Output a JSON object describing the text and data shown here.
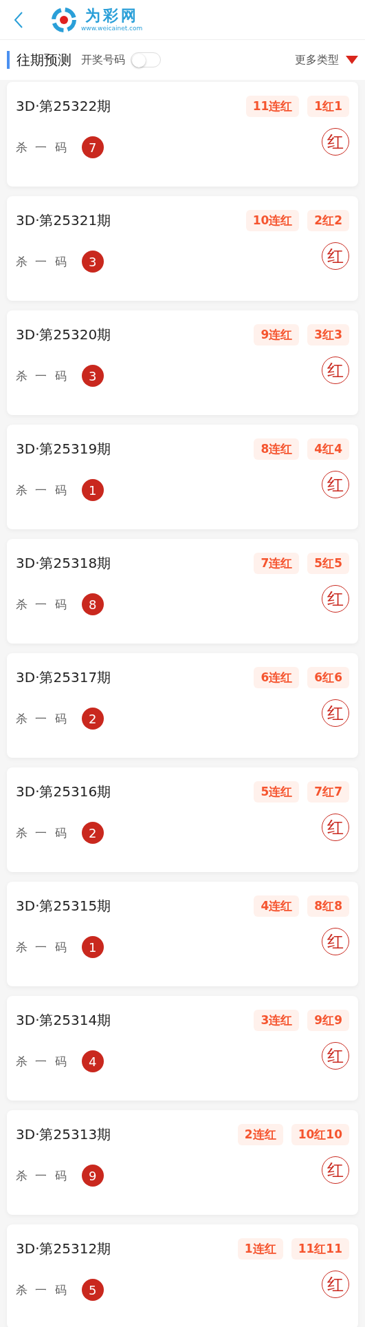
{
  "header": {
    "logo_name": "为彩网",
    "logo_url": "www.weicainet.com"
  },
  "section": {
    "title": "往期预测",
    "toggle": {
      "label": "开奖号码",
      "on": false
    },
    "more": "更多类型"
  },
  "cards": [
    {
      "period": "3D·第25322期",
      "streak": "11连红",
      "ratio": "1红1",
      "label": "杀 一 码",
      "number": "7",
      "result": "红"
    },
    {
      "period": "3D·第25321期",
      "streak": "10连红",
      "ratio": "2红2",
      "label": "杀 一 码",
      "number": "3",
      "result": "红"
    },
    {
      "period": "3D·第25320期",
      "streak": "9连红",
      "ratio": "3红3",
      "label": "杀 一 码",
      "number": "3",
      "result": "红"
    },
    {
      "period": "3D·第25319期",
      "streak": "8连红",
      "ratio": "4红4",
      "label": "杀 一 码",
      "number": "1",
      "result": "红"
    },
    {
      "period": "3D·第25318期",
      "streak": "7连红",
      "ratio": "5红5",
      "label": "杀 一 码",
      "number": "8",
      "result": "红"
    },
    {
      "period": "3D·第25317期",
      "streak": "6连红",
      "ratio": "6红6",
      "label": "杀 一 码",
      "number": "2",
      "result": "红"
    },
    {
      "period": "3D·第25316期",
      "streak": "5连红",
      "ratio": "7红7",
      "label": "杀 一 码",
      "number": "2",
      "result": "红"
    },
    {
      "period": "3D·第25315期",
      "streak": "4连红",
      "ratio": "8红8",
      "label": "杀 一 码",
      "number": "1",
      "result": "红"
    },
    {
      "period": "3D·第25314期",
      "streak": "3连红",
      "ratio": "9红9",
      "label": "杀 一 码",
      "number": "4",
      "result": "红"
    },
    {
      "period": "3D·第25313期",
      "streak": "2连红",
      "ratio": "10红10",
      "label": "杀 一 码",
      "number": "9",
      "result": "红"
    },
    {
      "period": "3D·第25312期",
      "streak": "1连红",
      "ratio": "11红11",
      "label": "杀 一 码",
      "number": "5",
      "result": "红"
    }
  ]
}
